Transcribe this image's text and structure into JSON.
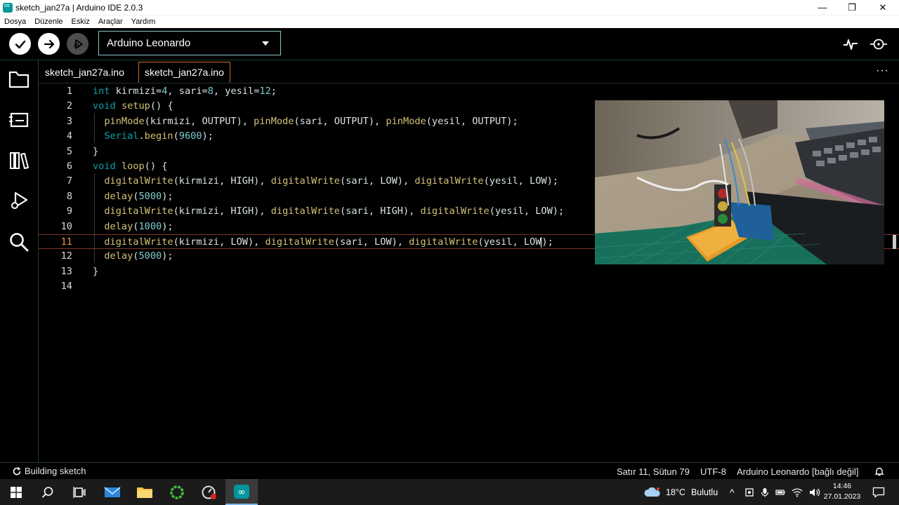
{
  "window": {
    "title": "sketch_jan27a | Arduino IDE 2.0.3",
    "minimize_glyph": "—",
    "maximize_glyph": "❐",
    "close_glyph": "✕"
  },
  "menu": [
    "Dosya",
    "Düzenle",
    "Eskiz",
    "Araçlar",
    "Yardım"
  ],
  "toolbar": {
    "board": "Arduino Leonardo"
  },
  "tabs": [
    {
      "label": "sketch_jan27a.ino",
      "active": false
    },
    {
      "label": "sketch_jan27a.ino",
      "active": true
    }
  ],
  "tabs_more": "···",
  "code": {
    "lines": [
      "1",
      "2",
      "3",
      "4",
      "5",
      "6",
      "7",
      "8",
      "9",
      "10",
      "11",
      "12",
      "13",
      "14"
    ],
    "current_line": "11"
  },
  "statusbar": {
    "activity": "Building sketch",
    "position": "Satır 11, Sütun 79",
    "encoding": "UTF-8",
    "board": "Arduino Leonardo [bağlı değil]"
  },
  "taskbar": {
    "weather": "18°C",
    "weather_desc": "Bulutlu",
    "tray_chevron": "^",
    "time": "14:46",
    "date": "27.01.2023"
  },
  "colors": {
    "accent": "#00979c",
    "keyword": "#0ca1a6",
    "function": "#d2c176",
    "number": "#7fcbcd",
    "current_line": "#e49754",
    "tab_active_border": "#c56a2b"
  }
}
